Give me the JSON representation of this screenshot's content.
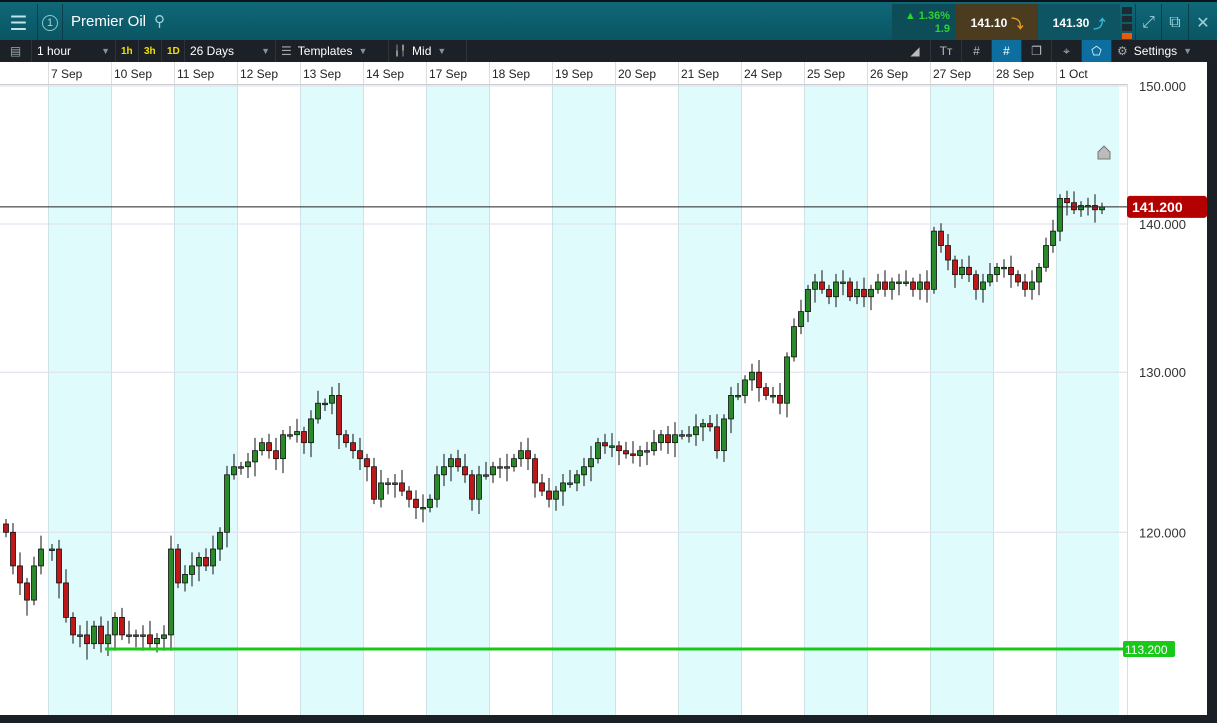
{
  "header": {
    "title": "Premier Oil",
    "badge": "1",
    "change_pct": "1.36%",
    "change_abs": "1.9",
    "sell_price": "141.10",
    "buy_price": "141.30"
  },
  "toolbar": {
    "interval": "1 hour",
    "quick": [
      "1h",
      "3h",
      "1D"
    ],
    "range": "26 Days",
    "templates": "Templates",
    "price_type": "Mid",
    "settings": "Settings"
  },
  "colors": {
    "up": "#2a8a2a",
    "down": "#c01818",
    "support": "#19c819",
    "last": "#b30000",
    "shade": "#e0fbfc"
  },
  "chart_data": {
    "type": "candlestick",
    "scale": "log",
    "ylim": [
      108,
      152
    ],
    "yticks": [
      "150.000",
      "140.000",
      "130.000",
      "120.000"
    ],
    "ytick_values": [
      150,
      140,
      130,
      120
    ],
    "days": [
      "7 Sep",
      "10 Sep",
      "11 Sep",
      "12 Sep",
      "13 Sep",
      "14 Sep",
      "17 Sep",
      "18 Sep",
      "19 Sep",
      "20 Sep",
      "21 Sep",
      "24 Sep",
      "25 Sep",
      "26 Sep",
      "27 Sep",
      "28 Sep",
      "1 Oct"
    ],
    "pre_closes": [
      120,
      118,
      117,
      116,
      118,
      119
    ],
    "closes": [
      [
        119,
        117,
        115,
        114,
        114,
        113.5,
        114.5,
        113.5,
        114
      ],
      [
        115,
        114,
        114,
        114,
        114,
        113.5,
        113.8,
        114,
        119
      ],
      [
        117,
        117.5,
        118,
        118.5,
        118,
        119,
        120,
        123.5,
        124
      ],
      [
        124,
        124.3,
        125,
        125.5,
        125,
        124.5,
        126,
        126,
        126.2
      ],
      [
        125.5,
        127,
        128,
        128,
        128.5,
        126,
        125.5,
        125,
        124.5
      ],
      [
        124,
        122,
        123,
        123,
        123,
        122.5,
        122,
        121.5,
        121.5
      ],
      [
        122,
        123.5,
        124,
        124.5,
        124,
        123.5,
        122,
        123.5,
        123.5
      ],
      [
        124,
        124,
        124,
        124.5,
        125,
        124.5,
        123,
        122.5,
        122
      ],
      [
        122.5,
        123,
        123,
        123.5,
        124,
        124.5,
        125.5,
        125.3,
        125.3
      ],
      [
        125,
        124.8,
        124.7,
        125,
        125,
        125.5,
        126,
        125.5,
        126
      ],
      [
        126,
        126,
        126.5,
        126.7,
        126.5,
        125,
        127,
        128.5,
        128.5
      ],
      [
        129.5,
        130,
        129,
        128.5,
        128.5,
        128,
        131,
        133,
        134
      ],
      [
        135.5,
        136,
        135.5,
        135,
        136,
        136,
        135,
        135.5,
        135
      ],
      [
        135.5,
        136,
        135.5,
        136,
        136,
        136,
        135.5,
        136,
        135.5
      ],
      [
        139.5,
        138.5,
        137.5,
        136.5,
        137,
        136.5,
        135.5,
        136,
        136.5
      ],
      [
        137,
        137,
        136.5,
        136,
        135.5,
        136,
        137,
        138.5,
        139.5
      ],
      [
        141.8,
        141.5,
        141,
        141.3,
        141.3,
        141,
        141.2
      ]
    ],
    "last_price": 141.2,
    "last_label": "141.200",
    "support_level": 113.2,
    "support_label": "113.200"
  }
}
